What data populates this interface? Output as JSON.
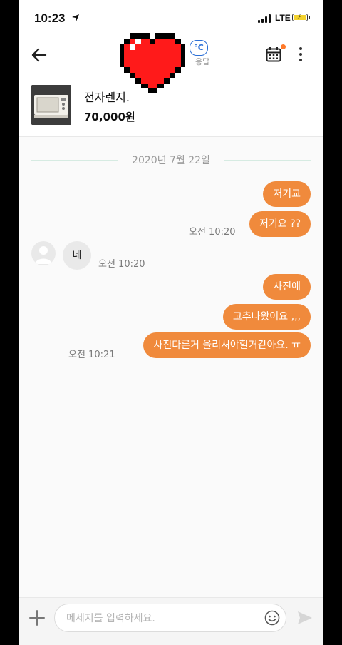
{
  "status_bar": {
    "time": "10:23",
    "network": "LTE"
  },
  "header": {
    "temperature_badge": "°C",
    "reply_rate_label": "응답"
  },
  "product": {
    "title": "전자렌지.",
    "price": "70,000원"
  },
  "chat": {
    "date": "2020년 7월 22일",
    "messages": [
      {
        "direction": "outgoing",
        "text": "저기교"
      },
      {
        "direction": "outgoing",
        "text": "저기요 ??",
        "time": "오전 10:20"
      },
      {
        "direction": "incoming",
        "text": "네",
        "time": "오전 10:20"
      },
      {
        "direction": "outgoing",
        "text": "사진에"
      },
      {
        "direction": "outgoing",
        "text": "고추나왔어요 ,,,"
      },
      {
        "direction": "outgoing",
        "text": "사진다른거 올리셔야할거같아요. ㅠ",
        "time": "오전 10:21"
      }
    ]
  },
  "input": {
    "placeholder": "메세지를 입력하세요."
  },
  "colors": {
    "accent": "#f08a3c",
    "incoming_bubble": "#e9e9e9",
    "date_line": "#d6ebe2",
    "heart_red": "#ff1a1a"
  },
  "icons": [
    "back-arrow-icon",
    "heart-sticker-icon",
    "calendar-icon",
    "more-vertical-icon",
    "plus-icon",
    "emoji-icon",
    "send-icon",
    "location-arrow-icon",
    "battery-icon"
  ]
}
